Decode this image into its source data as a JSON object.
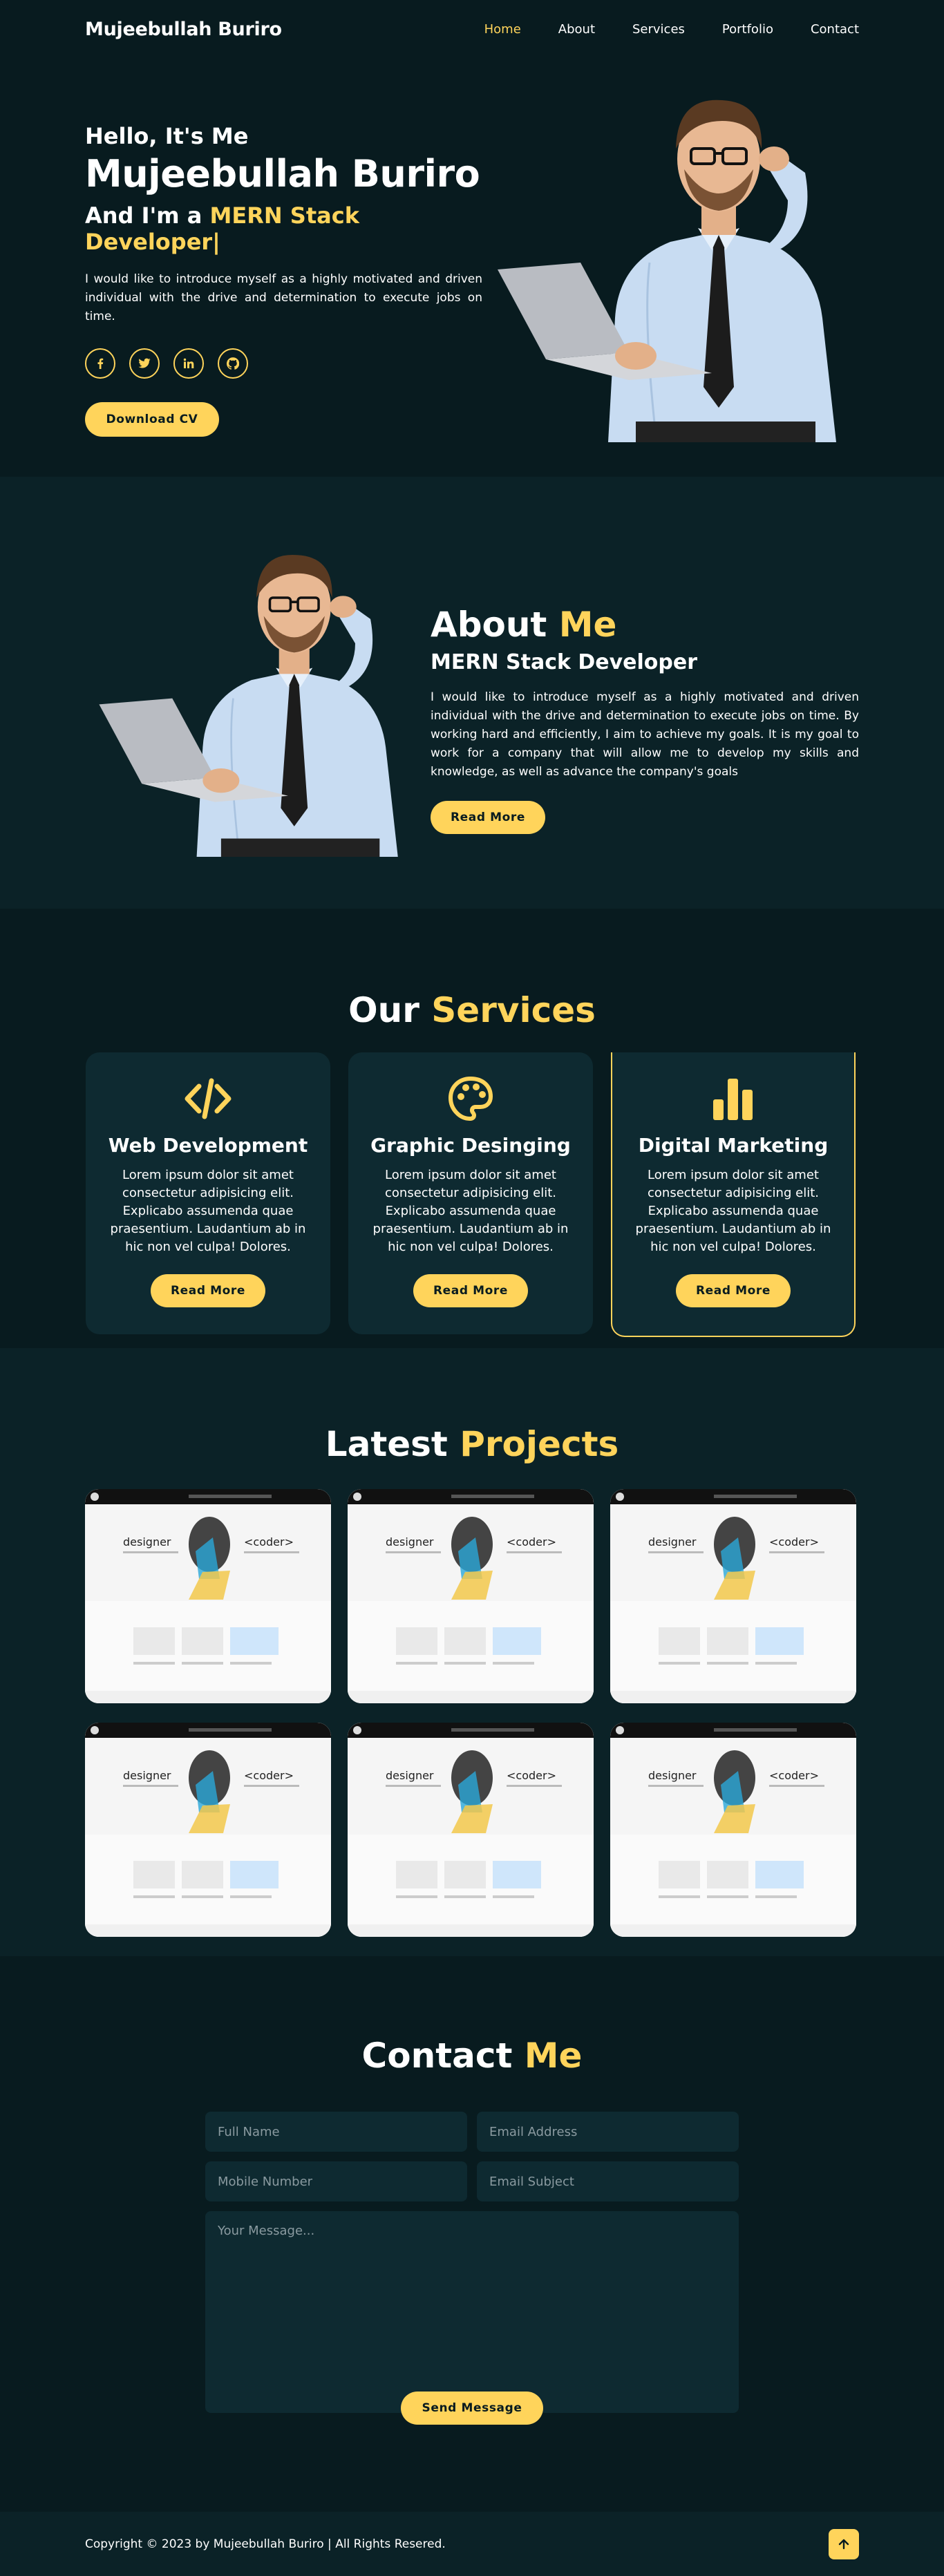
{
  "header": {
    "logo": "Mujeebullah Buriro",
    "nav": [
      {
        "label": "Home",
        "active": true
      },
      {
        "label": "About",
        "active": false
      },
      {
        "label": "Services",
        "active": false
      },
      {
        "label": "Portfolio",
        "active": false
      },
      {
        "label": "Contact",
        "active": false
      }
    ]
  },
  "home": {
    "hello": "Hello, It's Me",
    "name": "Mujeebullah Buriro",
    "role_prefix": "And I'm a ",
    "role_accent": "MERN Stack Developer|",
    "intro": "I would like to introduce myself as a highly motivated and driven individual with the drive and determination to execute jobs on time.",
    "socials": [
      {
        "icon": "facebook-icon",
        "glyph": "f"
      },
      {
        "icon": "twitter-icon",
        "glyph": "t"
      },
      {
        "icon": "linkedin-icon",
        "glyph": "in"
      },
      {
        "icon": "github-icon",
        "glyph": "gh"
      }
    ],
    "cv_button": "Download CV"
  },
  "about": {
    "heading": "About ",
    "heading_accent": "Me",
    "subtitle": "MERN Stack Developer",
    "paragraph": "I would like to introduce myself as a highly motivated and driven individual with the drive and determination to execute jobs on time. By working hard and efficiently, I aim to achieve my goals. It is my goal to work for a company that will allow me to develop my skills and knowledge, as well as advance the company's goals",
    "button": "Read More"
  },
  "services": {
    "heading": "Our ",
    "heading_accent": "Services",
    "cards": [
      {
        "icon": "code-icon",
        "title": "Web Development",
        "text": "Lorem ipsum dolor sit amet consectetur adipisicing elit. Explicabo assumenda quae praesentium. Laudantium ab in hic non vel culpa! Dolores.",
        "button": "Read More"
      },
      {
        "icon": "palette-icon",
        "title": "Graphic Desinging",
        "text": "Lorem ipsum dolor sit amet consectetur adipisicing elit. Explicabo assumenda quae praesentium. Laudantium ab in hic non vel culpa! Dolores.",
        "button": "Read More"
      },
      {
        "icon": "bar-chart-icon",
        "title": "Digital Marketing",
        "text": "Lorem ipsum dolor sit amet consectetur adipisicing elit. Explicabo assumenda quae praesentium. Laudantium ab in hic non vel culpa! Dolores.",
        "button": "Read More"
      }
    ]
  },
  "projects": {
    "heading": "Latest ",
    "heading_accent": "Projects",
    "thumb_text_left": "designer",
    "thumb_text_right": "<coder>",
    "count": 6
  },
  "contact": {
    "heading": "Contact ",
    "heading_accent": "Me",
    "fields": {
      "full_name": "Full Name",
      "email": "Email Address",
      "mobile": "Mobile Number",
      "subject": "Email Subject",
      "message": "Your Message..."
    },
    "button": "Send Message"
  },
  "footer": {
    "copyright": "Copyright © 2023 by Mujeebullah Buriro | All Rights Resered."
  },
  "colors": {
    "accent": "#ffd45b",
    "bg_dark": "#081b1f",
    "bg_second": "#0b2227",
    "card": "#0e2a31"
  }
}
